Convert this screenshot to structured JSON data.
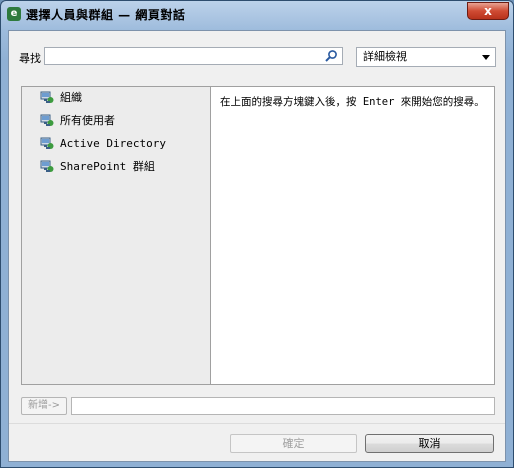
{
  "window": {
    "title": "選擇人員與群組 — 網頁對話",
    "close_glyph": "x"
  },
  "search": {
    "label": "尋找",
    "value": "",
    "placeholder": ""
  },
  "view": {
    "selected": "詳細檢視"
  },
  "tree": {
    "items": [
      {
        "label": "組織",
        "icon": "directory-icon"
      },
      {
        "label": "所有使用者",
        "icon": "directory-icon"
      },
      {
        "label": "Active Directory",
        "icon": "directory-icon"
      },
      {
        "label": "SharePoint 群組",
        "icon": "directory-icon"
      }
    ]
  },
  "results": {
    "hint": "在上面的搜尋方塊鍵入後，按 Enter 來開始您的搜尋。"
  },
  "add": {
    "button_label": "新增->",
    "value": ""
  },
  "buttons": {
    "ok": "確定",
    "cancel": "取消"
  }
}
